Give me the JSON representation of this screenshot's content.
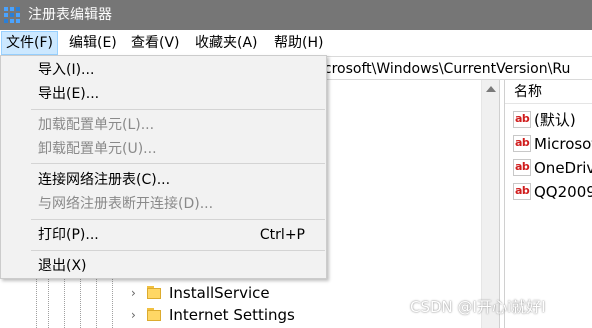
{
  "window": {
    "title": "注册表编辑器"
  },
  "menubar": {
    "items": [
      {
        "label": "文件(F)"
      },
      {
        "label": "编辑(E)"
      },
      {
        "label": "查看(V)"
      },
      {
        "label": "收藏夹(A)"
      },
      {
        "label": "帮助(H)"
      }
    ]
  },
  "address": {
    "path_visible": "icrosoft\\Windows\\CurrentVersion\\Ru"
  },
  "file_menu": {
    "items": [
      {
        "label": "导入(I)...",
        "enabled": true
      },
      {
        "label": "导出(E)...",
        "enabled": true
      },
      {
        "label": "加载配置单元(L)...",
        "enabled": false
      },
      {
        "label": "卸载配置单元(U)...",
        "enabled": false
      },
      {
        "label": "连接网络注册表(C)...",
        "enabled": true
      },
      {
        "label": "与网络注册表断开连接(D)...",
        "enabled": false
      },
      {
        "label": "打印(P)...",
        "shortcut": "Ctrl+P",
        "enabled": true
      },
      {
        "label": "退出(X)",
        "enabled": true
      }
    ]
  },
  "tree": {
    "nodes": [
      {
        "label": "InstallService",
        "icon": "folder-icon",
        "expander": "›"
      },
      {
        "label": "Internet Settings",
        "icon": "folder-icon",
        "expander": "›"
      }
    ]
  },
  "values_pane": {
    "column_name": "名称",
    "icon_text": "ab",
    "rows": [
      {
        "name": "(默认)"
      },
      {
        "name": "Microsoft"
      },
      {
        "name": "OneDrive"
      },
      {
        "name": "QQ2009"
      }
    ]
  },
  "watermark": {
    "text": "CSDN @I开心i就好I"
  },
  "colors": {
    "titlebar_bg": "#767676",
    "menu_active_bg": "#cce8ff",
    "dropdown_bg": "#f2f2f2",
    "disabled_text": "#8a8a8a",
    "ab_icon_red": "#d01c1c"
  }
}
